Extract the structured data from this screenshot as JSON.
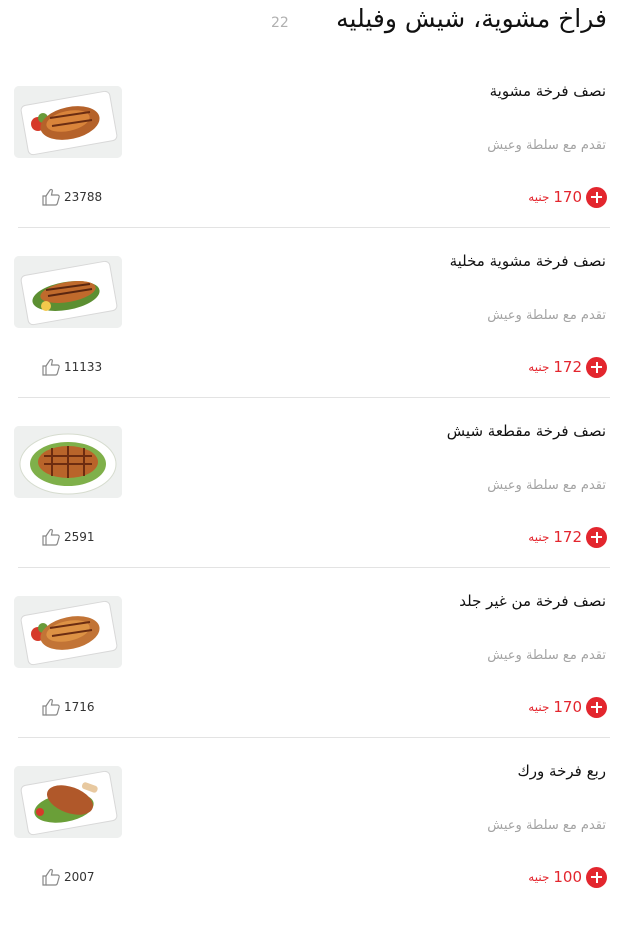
{
  "section": {
    "title": "فراخ مشوية، شيش وفيليه",
    "count": "22"
  },
  "items": [
    {
      "name": "نصف فرخة مشوية",
      "description": "تقدم مع سلطة وعيش",
      "price": "170",
      "currency": "جنيه",
      "likes": "23788",
      "image": "grilled-chicken-plate"
    },
    {
      "name": "نصف فرخة مشوية مخلية",
      "description": "تقدم مع سلطة وعيش",
      "price": "172",
      "currency": "جنيه",
      "likes": "11133",
      "image": "boneless-chicken-plate"
    },
    {
      "name": "نصف فرخة مقطعة شيش",
      "description": "تقدم مع سلطة وعيش",
      "price": "172",
      "currency": "جنيه",
      "likes": "2591",
      "image": "shish-chicken-plate"
    },
    {
      "name": "نصف فرخة من غير جلد",
      "description": "تقدم مع سلطة وعيش",
      "price": "170",
      "currency": "جنيه",
      "likes": "1716",
      "image": "skinless-chicken-plate"
    },
    {
      "name": "ربع فرخة ورك",
      "description": "تقدم مع سلطة وعيش",
      "price": "100",
      "currency": "جنيه",
      "likes": "2007",
      "image": "chicken-leg-plate"
    }
  ],
  "colors": {
    "accent": "#e3262e",
    "muted": "#a3a3a3",
    "divider": "#e3e3e3"
  }
}
